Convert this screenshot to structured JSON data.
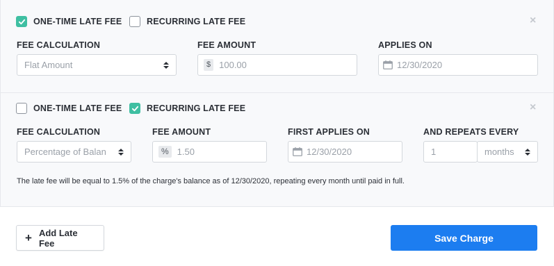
{
  "colors": {
    "check": "#3fbfa2",
    "primary": "#1c7df0"
  },
  "section1": {
    "one_time": {
      "label": "ONE-TIME LATE FEE",
      "checked": true
    },
    "recurring": {
      "label": "RECURRING LATE FEE",
      "checked": false
    },
    "fee_calculation": {
      "label": "FEE CALCULATION",
      "value": "Flat Amount"
    },
    "fee_amount": {
      "label": "FEE AMOUNT",
      "prefix": "$",
      "placeholder": "100.00"
    },
    "applies_on": {
      "label": "APPLIES ON",
      "placeholder": "12/30/2020"
    },
    "close_icon": "close-icon"
  },
  "section2": {
    "one_time": {
      "label": "ONE-TIME LATE FEE",
      "checked": false
    },
    "recurring": {
      "label": "RECURRING LATE FEE",
      "checked": true
    },
    "fee_calculation": {
      "label": "FEE CALCULATION",
      "value": "Percentage of Balan"
    },
    "fee_amount": {
      "label": "FEE AMOUNT",
      "prefix": "%",
      "placeholder": "1.50"
    },
    "first_applies_on": {
      "label": "FIRST APPLIES ON",
      "placeholder": "12/30/2020"
    },
    "repeats_every": {
      "label": "AND REPEATS EVERY",
      "count_placeholder": "1",
      "unit": "months"
    },
    "note": "The late fee will be equal to 1.5% of the charge's balance as of 12/30/2020, repeating every month until paid in full.",
    "close_icon": "close-icon"
  },
  "footer": {
    "add_label": "Add Late Fee",
    "save_label": "Save Charge"
  }
}
